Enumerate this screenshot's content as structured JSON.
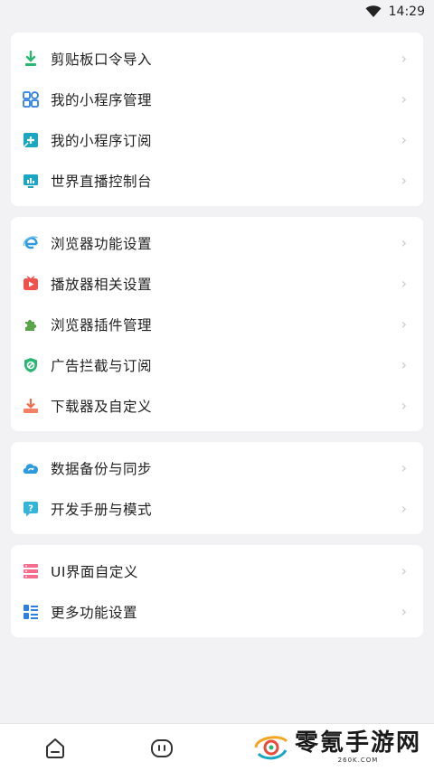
{
  "status": {
    "time": "14:29",
    "wifi_icon": "wifi-icon"
  },
  "groups": [
    {
      "items": [
        {
          "label": "剪贴板口令导入",
          "icon": "clipboard-import-icon"
        },
        {
          "label": "我的小程序管理",
          "icon": "miniprogram-grid-icon"
        },
        {
          "label": "我的小程序订阅",
          "icon": "miniprogram-subscribe-icon"
        },
        {
          "label": "世界直播控制台",
          "icon": "live-console-icon"
        }
      ]
    },
    {
      "items": [
        {
          "label": "浏览器功能设置",
          "icon": "browser-e-icon"
        },
        {
          "label": "播放器相关设置",
          "icon": "player-icon"
        },
        {
          "label": "浏览器插件管理",
          "icon": "plugin-puzzle-icon"
        },
        {
          "label": "广告拦截与订阅",
          "icon": "adblock-shield-icon"
        },
        {
          "label": "下载器及自定义",
          "icon": "download-icon"
        }
      ]
    },
    {
      "items": [
        {
          "label": "数据备份与同步",
          "icon": "cloud-sync-icon"
        },
        {
          "label": "开发手册与模式",
          "icon": "dev-manual-icon"
        }
      ]
    },
    {
      "items": [
        {
          "label": "UI界面自定义",
          "icon": "ui-custom-icon"
        },
        {
          "label": "更多功能设置",
          "icon": "more-settings-icon"
        }
      ]
    }
  ],
  "chevron": "›",
  "bottom_nav": {
    "home_icon": "home-icon",
    "mini_icon": "miniprogram-face-icon"
  },
  "watermark": {
    "text": "零氪手游网",
    "sub": "260K.COM"
  },
  "colors": {
    "green": "#2bb673",
    "blue": "#2d7fe0",
    "teal": "#1aa6c4",
    "red": "#f0524e",
    "orange": "#f26b4a",
    "pink": "#f56c8c",
    "plant_green": "#5aa54a",
    "cyan": "#33b5d9"
  }
}
